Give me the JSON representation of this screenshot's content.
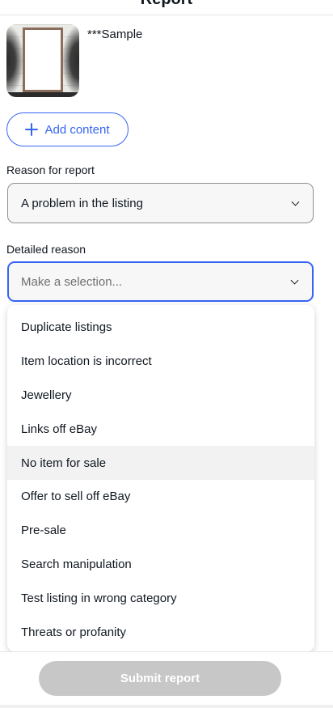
{
  "header": {
    "title": "Report"
  },
  "item": {
    "title": "***Sample"
  },
  "add_content": {
    "label": "Add content"
  },
  "reason": {
    "label": "Reason for report",
    "value": "A problem in the listing"
  },
  "detailed_reason": {
    "label": "Detailed reason",
    "placeholder": "Make a selection..."
  },
  "dropdown": {
    "options": [
      {
        "label": "Duplicate listings"
      },
      {
        "label": "Item location is incorrect"
      },
      {
        "label": "Jewellery"
      },
      {
        "label": "Links off eBay"
      },
      {
        "label": "No item for sale"
      },
      {
        "label": "Offer to sell off eBay"
      },
      {
        "label": "Pre-sale"
      },
      {
        "label": "Search manipulation"
      },
      {
        "label": "Test listing in wrong category"
      },
      {
        "label": "Threats or profanity"
      }
    ],
    "hovered_index": 4
  },
  "submit": {
    "label": "Submit report",
    "disabled": true
  },
  "colors": {
    "accent": "#3665f3",
    "disabled_button": "#c7c7c7",
    "text": "#111820"
  }
}
